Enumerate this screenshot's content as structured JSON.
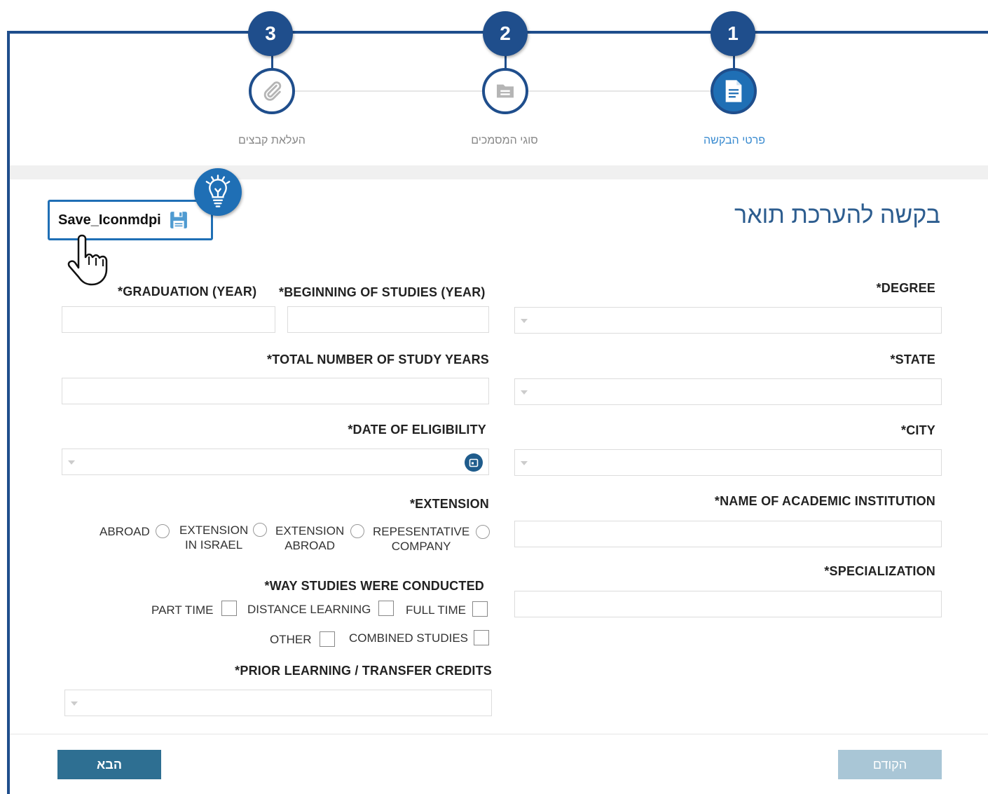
{
  "wizard": {
    "steps": [
      {
        "number": "1",
        "label": "פרטי הבקשה",
        "icon": "document-icon",
        "state": "active"
      },
      {
        "number": "2",
        "label": "סוגי המסמכים",
        "icon": "folder-icon",
        "state": "pending"
      },
      {
        "number": "3",
        "label": "העלאת קבצים",
        "icon": "paperclip-icon",
        "state": "pending"
      }
    ]
  },
  "annotation": {
    "save_label": "Save_Iconmdpi",
    "save_icon": "floppy-disk-icon",
    "tip_icon": "lightbulb-icon",
    "pointer_icon": "hand-pointer-icon"
  },
  "form": {
    "title": "בקשה להערכת תואר",
    "degree": {
      "label": "*DEGREE",
      "value": ""
    },
    "state": {
      "label": "*STATE",
      "value": ""
    },
    "city": {
      "label": "*CITY",
      "value": ""
    },
    "institution": {
      "label": "*NAME OF ACADEMIC INSTITUTION",
      "value": ""
    },
    "specialization": {
      "label": "*SPECIALIZATION",
      "value": ""
    },
    "graduation_year": {
      "label": "*GRADUATION (YEAR)",
      "value": ""
    },
    "beginning_year": {
      "label": "*BEGINNING OF STUDIES (YEAR)",
      "value": ""
    },
    "total_years": {
      "label": "*TOTAL NUMBER OF STUDY YEARS",
      "value": ""
    },
    "eligibility_date": {
      "label": "*DATE OF ELIGIBILITY",
      "value": ""
    },
    "extension": {
      "label": "*EXTENSION",
      "options": [
        "ABROAD",
        "EXTENSION\nIN ISRAEL",
        "EXTENSION\nABROAD",
        "REPESENTATIVE\nCOMPANY"
      ]
    },
    "study_mode": {
      "label": "*WAY STUDIES WERE CONDUCTED",
      "options": [
        "PART TIME",
        "DISTANCE LEARNING",
        "FULL TIME",
        "OTHER",
        "COMBINED STUDIES"
      ]
    },
    "prior_learning": {
      "label": "*PRIOR LEARNING / TRANSFER CREDITS",
      "value": ""
    }
  },
  "footer": {
    "next_label": "הבא",
    "prev_label": "הקודם"
  },
  "colors": {
    "frame": "#1f4e8c",
    "accent": "#1f6fb5",
    "next_button": "#2e6f92",
    "prev_button": "#a9c6d6",
    "title": "#2d5d8f"
  }
}
